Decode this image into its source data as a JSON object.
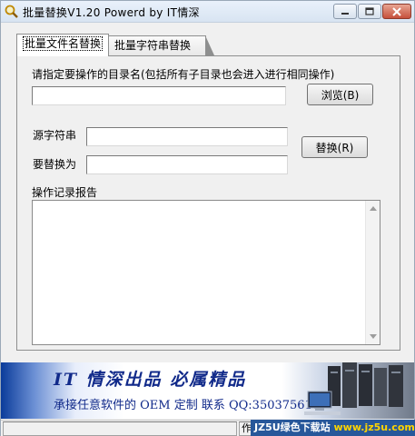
{
  "window": {
    "title": "批量替换V1.20  Powerd by IT情深"
  },
  "tabs": [
    {
      "label": "批量文件名替换",
      "active": true
    },
    {
      "label": "批量字符串替换",
      "active": false
    }
  ],
  "form": {
    "dir_label": "请指定要操作的目录名(包括所有子目录也会进入进行相同操作)",
    "dir_value": "",
    "browse_label": "浏览(B)",
    "source_label": "源字符串",
    "source_value": "",
    "replace_with_label": "要替换为",
    "replace_with_value": "",
    "replace_button_label": "替换(R)",
    "log_label": "操作记录报告",
    "log_value": ""
  },
  "banner": {
    "title": "IT 情深出品  必属精品",
    "subtitle": "承接任意软件的 OEM 定制  联系 QQ:350375616"
  },
  "statusbar": {
    "field1": "",
    "field2": "作"
  },
  "watermark": {
    "site": "JZ5U绿色下载站",
    "url": "www.jz5u.com"
  },
  "colors": {
    "banner_text": "#112a8a",
    "close_button": "#c6503b"
  }
}
